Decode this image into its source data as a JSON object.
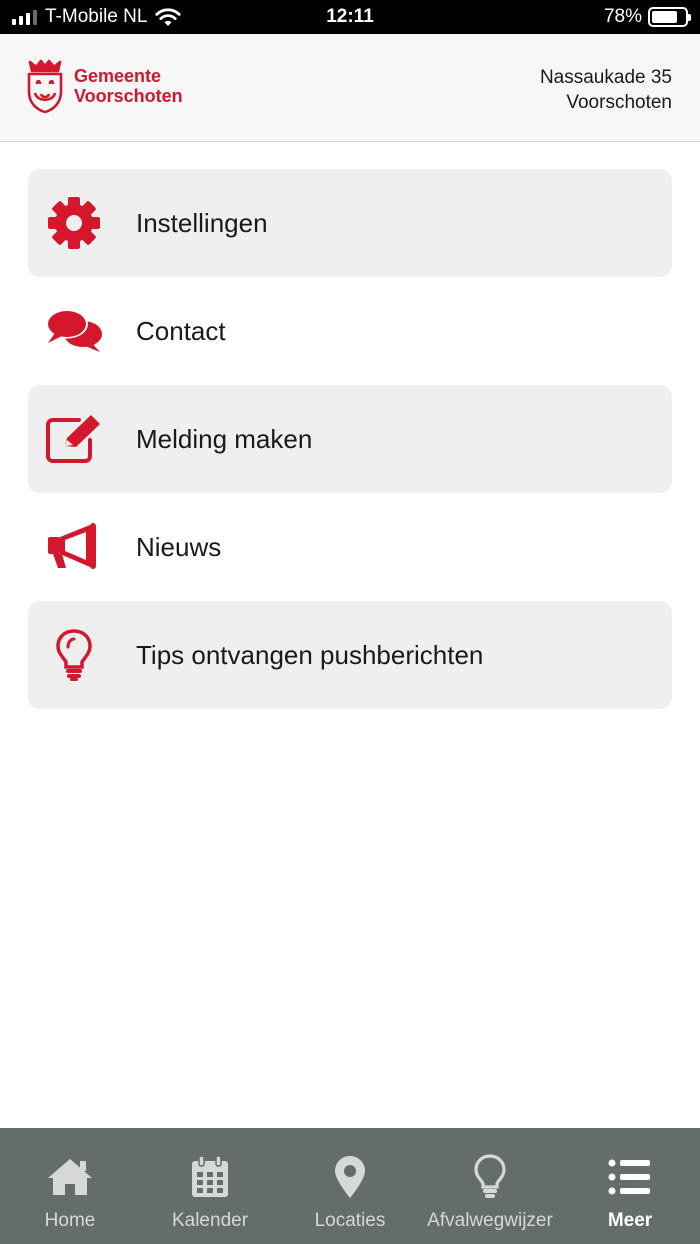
{
  "status_bar": {
    "carrier": "T-Mobile NL",
    "time": "12:11",
    "battery_text": "78%",
    "battery_level": 0.78
  },
  "header": {
    "logo_line1": "Gemeente",
    "logo_line2": "Voorschoten",
    "address_line1": "Nassaukade 35",
    "address_line2": "Voorschoten"
  },
  "menu": {
    "items": [
      {
        "label": "Instellingen",
        "icon": "gear-icon"
      },
      {
        "label": "Contact",
        "icon": "chat-bubbles-icon"
      },
      {
        "label": "Melding maken",
        "icon": "edit-icon"
      },
      {
        "label": "Nieuws",
        "icon": "megaphone-icon"
      },
      {
        "label": "Tips ontvangen pushberichten",
        "icon": "lightbulb-icon"
      }
    ]
  },
  "tabbar": {
    "tabs": [
      {
        "label": "Home",
        "icon": "home-icon"
      },
      {
        "label": "Kalender",
        "icon": "calendar-icon"
      },
      {
        "label": "Locaties",
        "icon": "location-pin-icon"
      },
      {
        "label": "Afvalwegwijzer",
        "icon": "lightbulb-icon"
      },
      {
        "label": "Meer",
        "icon": "list-icon",
        "active": true
      }
    ]
  },
  "colors": {
    "brand_red": "#d4172c",
    "tabbar_bg": "#646d6b",
    "item_shade": "#efefef"
  }
}
